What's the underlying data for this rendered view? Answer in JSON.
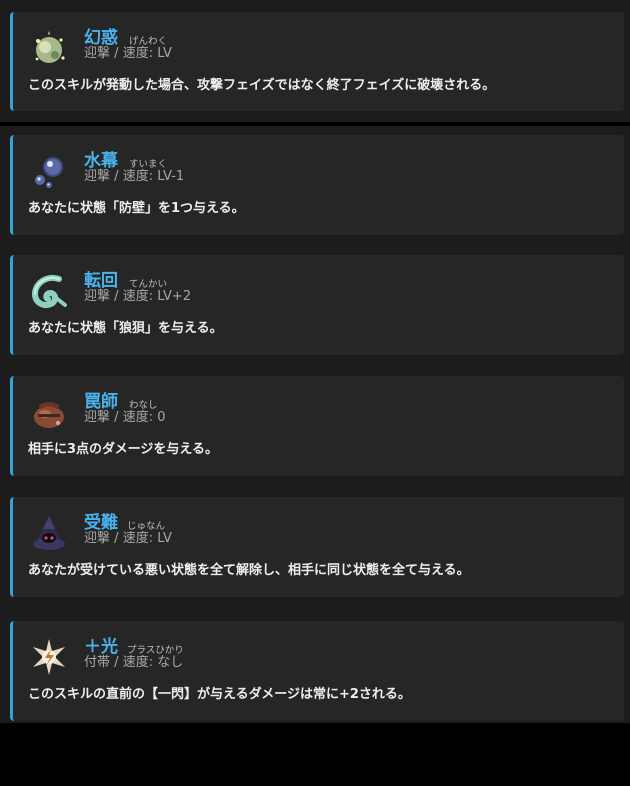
{
  "skills": [
    {
      "name": "幻惑",
      "ruby": "げんわく",
      "type": "迎撃",
      "speed_label": "速度:",
      "speed": "LV",
      "description": "このスキルが発動した場合、攻撃フェイズではなく終了フェイズに破壊される。",
      "icon": "glittering-orb-icon"
    },
    {
      "name": "水幕",
      "ruby": "すいまく",
      "type": "迎撃",
      "speed_label": "速度:",
      "speed": "LV-1",
      "description": "あなたに状態「防壁」を1つ与える。",
      "icon": "water-bubbles-icon"
    },
    {
      "name": "転回",
      "ruby": "てんかい",
      "type": "迎撃",
      "speed_label": "速度:",
      "speed": "LV+2",
      "description": "あなたに状態「狼狽」を与える。",
      "icon": "curl-wave-icon"
    },
    {
      "name": "罠師",
      "ruby": "わなし",
      "type": "迎撃",
      "speed_label": "速度:",
      "speed": "0",
      "description": "相手に3点のダメージを与える。",
      "icon": "pouch-icon"
    },
    {
      "name": "受難",
      "ruby": "じゅなん",
      "type": "迎撃",
      "speed_label": "速度:",
      "speed": "LV",
      "description": "あなたが受けている悪い状態を全て解除し、相手に同じ状態を全て与える。",
      "icon": "dark-hood-icon"
    },
    {
      "name": "＋光",
      "ruby": "プラスひかり",
      "type": "付帯",
      "speed_label": "速度:",
      "speed": "なし",
      "description": "このスキルの直前の【一閃】が与えるダメージは常に+2される。",
      "icon": "lightning-sparkle-icon"
    }
  ],
  "separator": "/",
  "colors": {
    "accent": "#3aa0d6",
    "name": "#49b3ee",
    "card": "#262626",
    "panel": "#1c1c1c"
  }
}
